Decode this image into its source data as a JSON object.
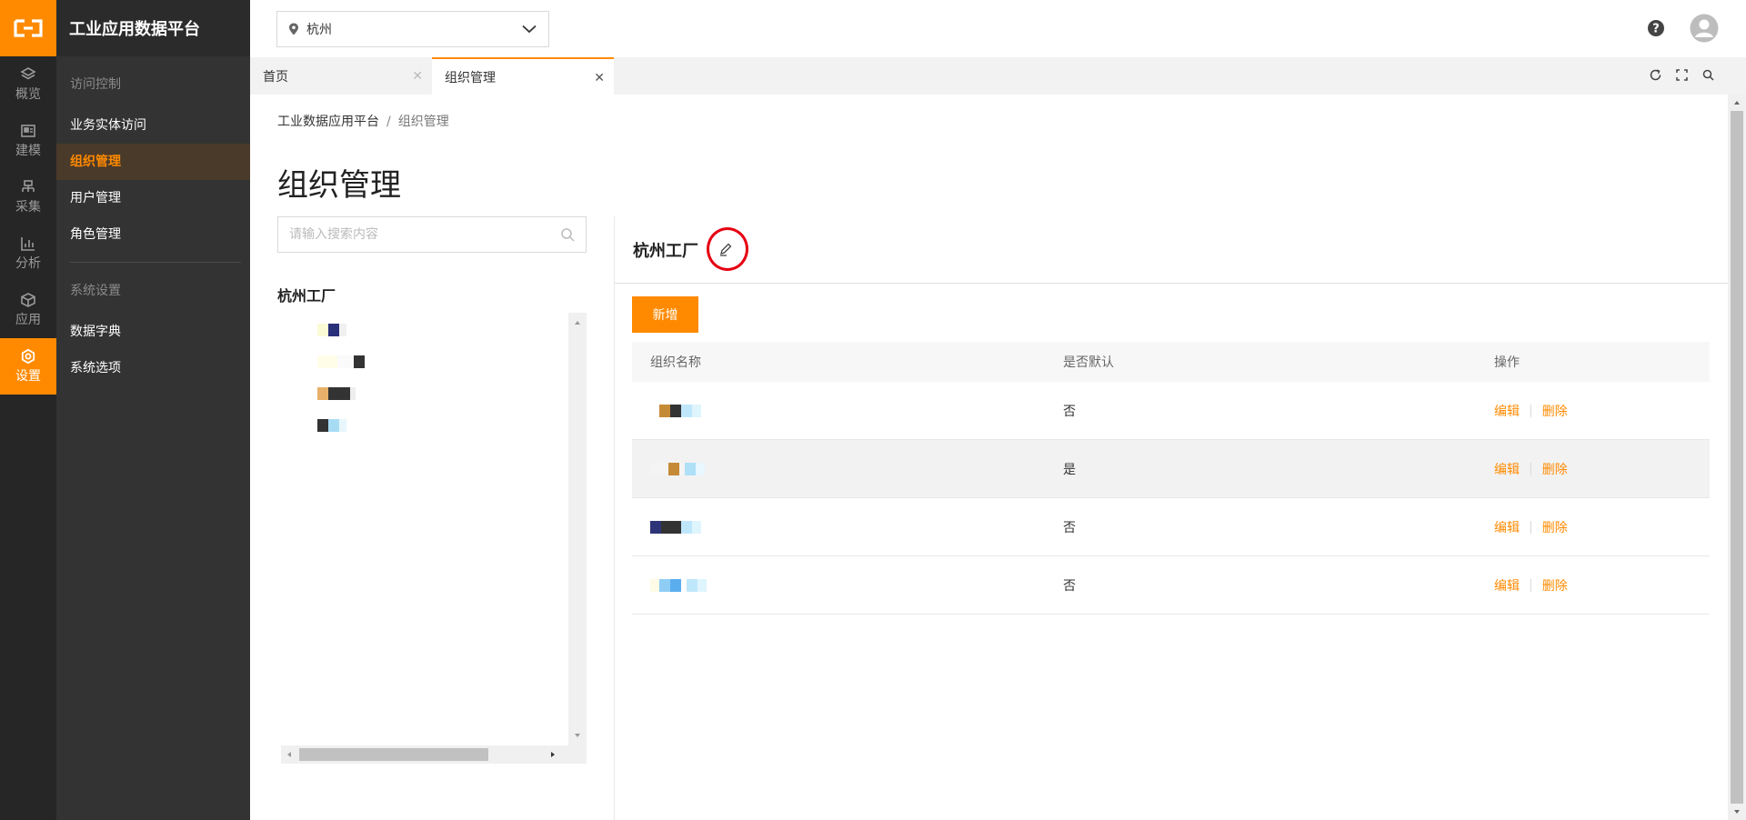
{
  "app": {
    "title": "工业应用数据平台"
  },
  "rail": [
    {
      "label": "概览",
      "icon": "layers-icon"
    },
    {
      "label": "建模",
      "icon": "dashboard-icon"
    },
    {
      "label": "采集",
      "icon": "collect-icon"
    },
    {
      "label": "分析",
      "icon": "chart-icon"
    },
    {
      "label": "应用",
      "icon": "cube-icon"
    },
    {
      "label": "设置",
      "icon": "gear-icon",
      "active": true
    }
  ],
  "menu": {
    "group1": "访问控制",
    "item1": "业务实体访问",
    "item2": "组织管理",
    "item3": "用户管理",
    "item4": "角色管理",
    "group2": "系统设置",
    "item5": "数据字典",
    "item6": "系统选项"
  },
  "topbar": {
    "city": "杭州"
  },
  "tabs": {
    "home": "首页",
    "org": "组织管理"
  },
  "breadcrumb": {
    "root": "工业数据应用平台",
    "sep": "/",
    "current": "组织管理"
  },
  "page": {
    "title": "组织管理"
  },
  "search": {
    "placeholder": "请输入搜索内容"
  },
  "tree": {
    "root": "杭州工厂"
  },
  "detail": {
    "title": "杭州工厂"
  },
  "toolbar": {
    "add_label": "新增"
  },
  "table": {
    "headers": {
      "name": "组织名称",
      "default": "是否默认",
      "ops": "操作"
    },
    "rows": [
      {
        "default": "否",
        "edit": "编辑",
        "delete": "删除"
      },
      {
        "default": "是",
        "edit": "编辑",
        "delete": "删除"
      },
      {
        "default": "否",
        "edit": "编辑",
        "delete": "删除"
      },
      {
        "default": "否",
        "edit": "编辑",
        "delete": "删除"
      }
    ]
  },
  "colors": {
    "accent": "#ff8a00",
    "highlight": "#e60012"
  }
}
